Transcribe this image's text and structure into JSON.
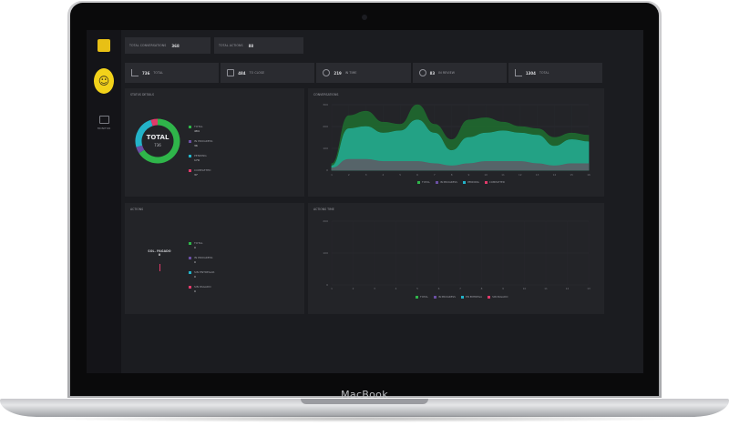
{
  "device": {
    "brand_label": "MacBook"
  },
  "topbar": {
    "conversations_label": "TOTAL CONVERSATIONS",
    "conversations_value": "368",
    "actions_label": "TOTAL ACTIONS",
    "actions_value": "88"
  },
  "sidebar": {
    "nav_label": "MONITOR"
  },
  "stats": [
    {
      "icon": "trend-chart-icon",
      "value": "736",
      "label": "TOTAL"
    },
    {
      "icon": "document-icon",
      "value": "484",
      "label": "TO CLOSE"
    },
    {
      "icon": "check-circle-icon",
      "value": "219",
      "label": "IN TIME"
    },
    {
      "icon": "check-circle-icon",
      "value": "83",
      "label": "IN REVIEW"
    },
    {
      "icon": "trend-chart-icon",
      "value": "1304",
      "label": "TOTAL"
    }
  ],
  "panels": {
    "p1": {
      "title": "STATUS DETAILS",
      "donut_label": "TOTAL",
      "donut_value": "736",
      "legend": [
        {
          "label": "TOTAL",
          "value": "484",
          "color": "#2fb54a"
        },
        {
          "label": "IN PROGRESS",
          "value": "36",
          "color": "#6a4fa3"
        },
        {
          "label": "PENDING",
          "value": "179",
          "color": "#23b3c9"
        },
        {
          "label": "COMPLETED",
          "value": "37",
          "color": "#e03a6a"
        }
      ]
    },
    "p2": {
      "title": "CONVERSATIONS",
      "legend": [
        {
          "label": "TOTAL",
          "color": "#2fb54a"
        },
        {
          "label": "IN PROGRESS",
          "color": "#6a4fa3"
        },
        {
          "label": "PENDING",
          "color": "#23b3c9"
        },
        {
          "label": "COMPLETED",
          "color": "#e03a6a"
        }
      ]
    },
    "p3": {
      "title": "ACTIONS",
      "center_label": "SOL. PAGADO",
      "center_value": "0",
      "legend": [
        {
          "label": "TOTAL",
          "value": "0",
          "color": "#2fb54a"
        },
        {
          "label": "IN PROGRESS",
          "value": "0",
          "color": "#6a4fa3"
        },
        {
          "label": "SIN ENTREGAR",
          "value": "0",
          "color": "#23b3c9"
        },
        {
          "label": "SIN PAGADO",
          "value": "0",
          "color": "#e03a6a"
        }
      ]
    },
    "p4": {
      "title": "ACTIONS TIME",
      "legend": [
        {
          "label": "TOTAL",
          "color": "#2fb54a"
        },
        {
          "label": "IN PROGRESS",
          "color": "#6a4fa3"
        },
        {
          "label": "EN ENTREGA",
          "color": "#23b3c9"
        },
        {
          "label": "SIN PAGADO",
          "color": "#e03a6a"
        }
      ]
    }
  },
  "chart_data": [
    {
      "type": "pie",
      "title": "STATUS DETAILS",
      "labels": [
        "TOTAL",
        "IN PROGRESS",
        "PENDING",
        "COMPLETED"
      ],
      "values": [
        484,
        36,
        179,
        37
      ],
      "colors": [
        "#2fb54a",
        "#6a4fa3",
        "#23b3c9",
        "#e03a6a"
      ]
    },
    {
      "type": "area",
      "title": "CONVERSATIONS",
      "categories": [
        "1",
        "2",
        "3",
        "4",
        "5",
        "6",
        "7",
        "8",
        "9",
        "10",
        "11",
        "12",
        "13",
        "14",
        "15",
        "16"
      ],
      "y_ticks": [
        "0",
        "100",
        "200",
        "300"
      ],
      "ylim": [
        0,
        300
      ],
      "series": [
        {
          "name": "TOTAL",
          "color": "#1f6a2f",
          "values": [
            30,
            250,
            270,
            220,
            210,
            300,
            210,
            140,
            230,
            240,
            220,
            200,
            190,
            150,
            170,
            160
          ]
        },
        {
          "name": "PENDING",
          "color": "#23a88f",
          "values": [
            20,
            190,
            200,
            170,
            180,
            230,
            170,
            90,
            150,
            170,
            180,
            170,
            160,
            110,
            140,
            130
          ]
        },
        {
          "name": "COMPLETED",
          "color": "#5c5d66",
          "values": [
            10,
            50,
            50,
            40,
            40,
            40,
            30,
            20,
            30,
            40,
            40,
            40,
            30,
            20,
            30,
            30
          ]
        }
      ]
    },
    {
      "type": "line",
      "title": "ACTIONS TIME",
      "categories": [
        "1",
        "2",
        "3",
        "4",
        "5",
        "6",
        "7",
        "8",
        "9",
        "10",
        "11",
        "12",
        "13"
      ],
      "y_ticks": [
        "0",
        "100",
        "200"
      ],
      "ylim": [
        0,
        200
      ],
      "series": []
    }
  ]
}
